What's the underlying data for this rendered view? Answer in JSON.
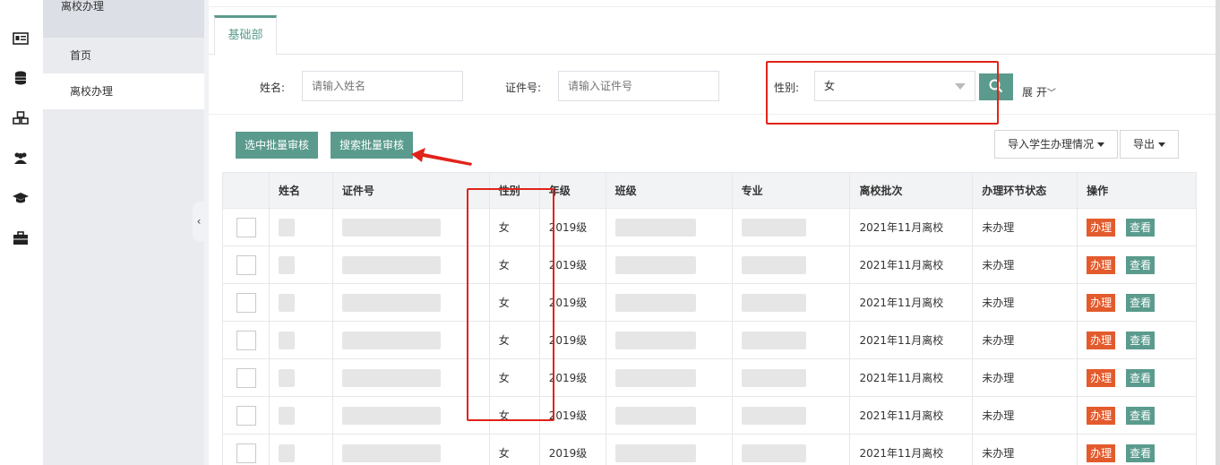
{
  "sidebar": {
    "rail_icons": [
      "dashboard-icon",
      "id-card-icon",
      "database-icon",
      "cubes-icon",
      "users-icon",
      "graduation-cap-icon",
      "briefcase-icon"
    ],
    "section_title": "离校办理",
    "items": [
      {
        "label": "首页",
        "active": false
      },
      {
        "label": "离校办理",
        "active": true
      }
    ]
  },
  "tabs": [
    {
      "label": "基础部",
      "active": true
    }
  ],
  "search": {
    "name_label": "姓名:",
    "name_placeholder": "请输入姓名",
    "id_label": "证件号:",
    "id_placeholder": "请输入证件号",
    "gender_label": "性别:",
    "gender_value": "女",
    "expand_label": "展 开"
  },
  "toolbar": {
    "batch_selected": "选中批量审核",
    "batch_search": "搜索批量审核",
    "import_label": "导入学生办理情况",
    "export_label": "导出"
  },
  "table": {
    "headers": [
      "",
      "姓名",
      "证件号",
      "性别",
      "年级",
      "班级",
      "专业",
      "离校批次",
      "办理环节状态",
      "操作"
    ],
    "rows": [
      {
        "gender": "女",
        "grade": "2019级",
        "batch": "2021年11月离校",
        "status": "未办理"
      },
      {
        "gender": "女",
        "grade": "2019级",
        "batch": "2021年11月离校",
        "status": "未办理"
      },
      {
        "gender": "女",
        "grade": "2019级",
        "batch": "2021年11月离校",
        "status": "未办理"
      },
      {
        "gender": "女",
        "grade": "2019级",
        "batch": "2021年11月离校",
        "status": "未办理"
      },
      {
        "gender": "女",
        "grade": "2019级",
        "batch": "2021年11月离校",
        "status": "未办理"
      },
      {
        "gender": "女",
        "grade": "2019级",
        "batch": "2021年11月离校",
        "status": "未办理"
      },
      {
        "gender": "女",
        "grade": "2019级",
        "batch": "2021年11月离校",
        "status": "未办理"
      }
    ],
    "action_do": "办理",
    "action_view": "查看"
  },
  "colors": {
    "accent_green": "#5a9b8d",
    "action_orange": "#e35b2d",
    "annotation_red": "#e1231a"
  }
}
